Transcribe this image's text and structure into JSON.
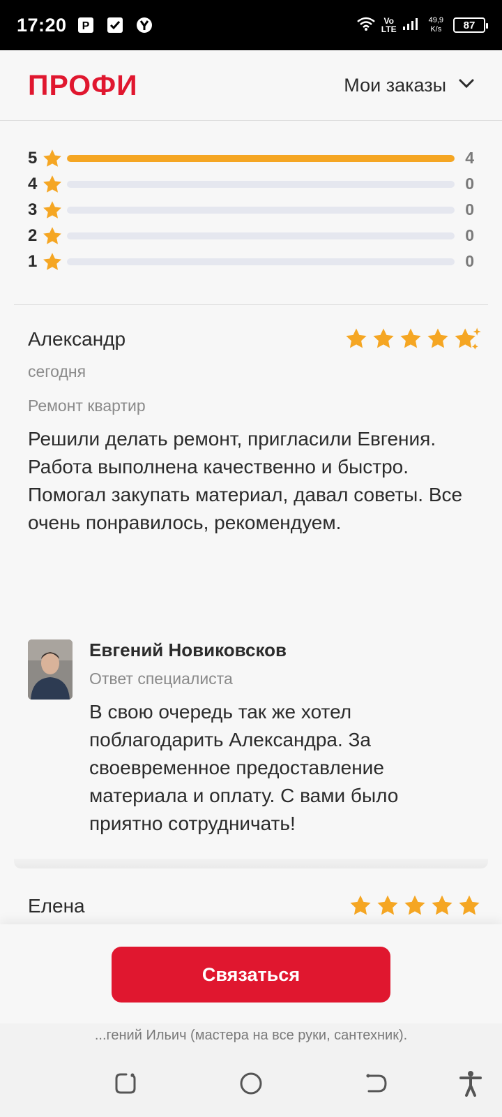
{
  "status_bar": {
    "time": "17:20",
    "volte_top": "Vo",
    "volte_bottom": "LTE",
    "speed_top": "49,9",
    "speed_bottom": "K/s",
    "battery": "87"
  },
  "header": {
    "logo": "ПРОФИ",
    "menu_label": "Мои заказы"
  },
  "colors": {
    "brand": "#e0172f",
    "star": "#f5a623"
  },
  "rating_histogram": [
    {
      "stars": "5",
      "count": "4",
      "fraction": 1.0
    },
    {
      "stars": "4",
      "count": "0",
      "fraction": 0
    },
    {
      "stars": "3",
      "count": "0",
      "fraction": 0
    },
    {
      "stars": "2",
      "count": "0",
      "fraction": 0
    },
    {
      "stars": "1",
      "count": "0",
      "fraction": 0
    }
  ],
  "review": {
    "author": "Александр",
    "rating": 5,
    "date": "сегодня",
    "category": "Ремонт квартир",
    "text": "Решили делать ремонт, пригласили Евгения. Работа выполнена качественно и быстро. Помогал закупать материал, давал советы. Все очень понравилось, рекомендуем."
  },
  "reply": {
    "name": "Евгений Новиковсков",
    "role": "Ответ специалиста",
    "text": "В свою очередь так же хотел поблагодарить Александра. За своевременное предоставление материала и оплату. С вами было приятно сотрудничать!"
  },
  "review2": {
    "author": "Елена",
    "rating": 5
  },
  "contact_button": "Связаться",
  "nav": {
    "caption": "...гений Ильич (мастера на все руки, сантехник)."
  }
}
